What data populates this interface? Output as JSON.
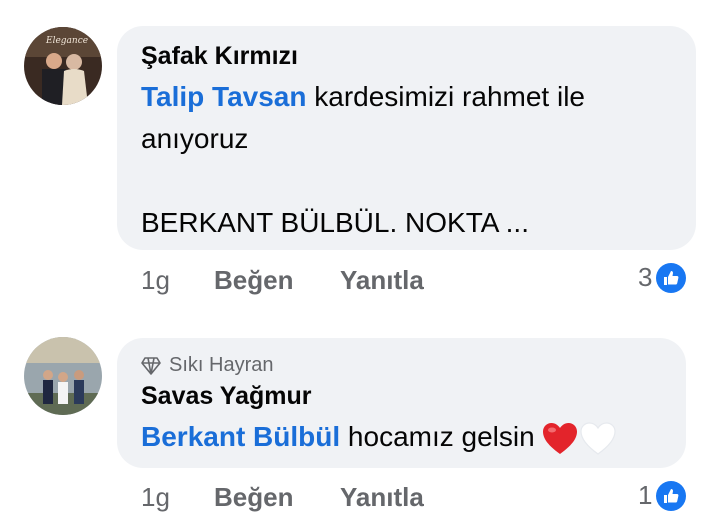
{
  "comments": [
    {
      "author": "Şafak Kırmızı",
      "mention": "Talip Tavsan",
      "text_line1": " kardesimizi rahmet ile",
      "text_line2": "anıyoruz",
      "text_line3": "BERKANT BÜLBÜL. NOKTA ...",
      "time": "1g",
      "like_label": "Beğen",
      "reply_label": "Yanıtla",
      "reaction_count": "3"
    },
    {
      "badge": "Sıkı Hayran",
      "author": "Savas Yağmur",
      "mention": "Berkant Bülbül",
      "text": " hocamız gelsin",
      "time": "1g",
      "like_label": "Beğen",
      "reply_label": "Yanıtla",
      "reaction_count": "1"
    }
  ],
  "colors": {
    "bubble": "#f0f2f5",
    "mention": "#1a6ed8",
    "meta": "#65676b",
    "like": "#1877f2"
  },
  "icons": [
    "avatar-photo",
    "like-thumb-icon",
    "diamond-icon",
    "red-heart-emoji",
    "white-heart-emoji"
  ]
}
